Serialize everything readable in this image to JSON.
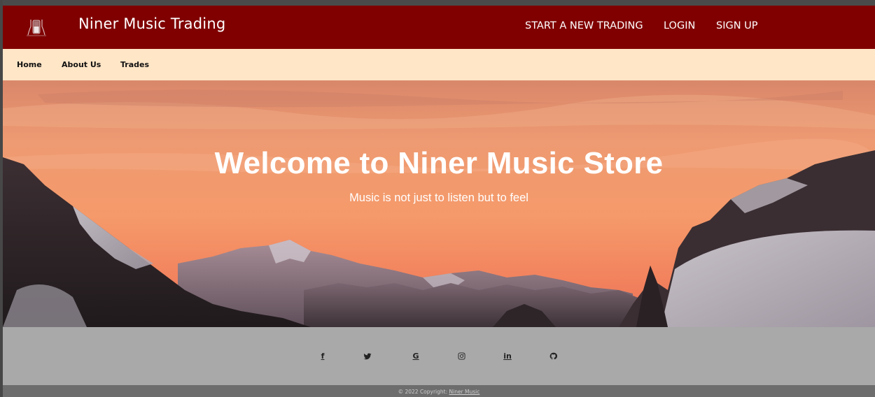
{
  "header": {
    "brand": "Niner Music Trading",
    "logo_icon": "guitar-logo-icon",
    "nav": {
      "start_trading": "START A NEW TRADING",
      "login": "LOGIN",
      "signup": "SIGN UP"
    },
    "background_color": "#800000"
  },
  "subnav": {
    "home": "Home",
    "about": "About Us",
    "trades": "Trades",
    "background_color": "#ffe6c7"
  },
  "hero": {
    "title": "Welcome to Niner Music Store",
    "subtitle": "Music is not just to listen but to feel"
  },
  "social": {
    "background_color": "#a9a9a9",
    "icons": [
      {
        "name": "facebook-icon",
        "glyph": "f"
      },
      {
        "name": "twitter-icon",
        "glyph": "🐦"
      },
      {
        "name": "google-icon",
        "glyph": "G"
      },
      {
        "name": "instagram-icon",
        "glyph": "◎"
      },
      {
        "name": "linkedin-icon",
        "glyph": "in"
      },
      {
        "name": "github-icon",
        "glyph": "○"
      }
    ]
  },
  "footer": {
    "copyright_prefix": "© 2022 Copyright: ",
    "copyright_link": "Niner Music"
  }
}
